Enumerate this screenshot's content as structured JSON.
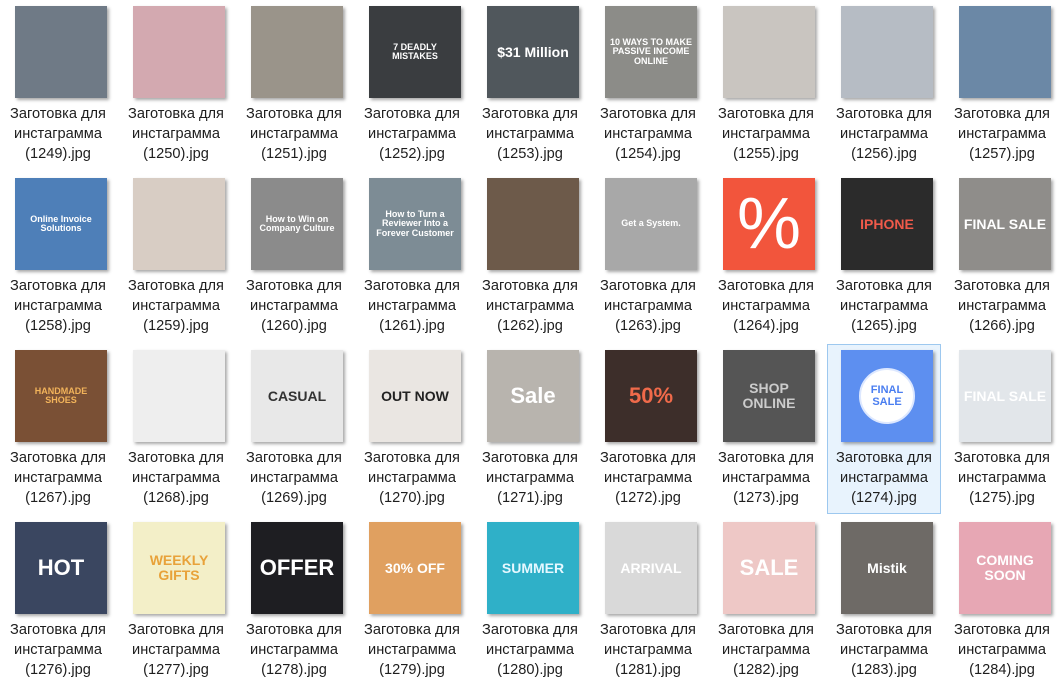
{
  "grid": {
    "columns": 9,
    "selected_index": 25
  },
  "files": [
    {
      "name_line1": "Заготовка для",
      "name_line2": "инстаграмма",
      "name_line3": "(1249).jpg",
      "bg": "#6f7a86",
      "overlay": "",
      "overlay_color": "#ffffff"
    },
    {
      "name_line1": "Заготовка для",
      "name_line2": "инстаграмма",
      "name_line3": "(1250).jpg",
      "bg": "#d3a9b0",
      "overlay": "",
      "overlay_color": "#ffffff"
    },
    {
      "name_line1": "Заготовка для",
      "name_line2": "инстаграмма",
      "name_line3": "(1251).jpg",
      "bg": "#9a948a",
      "overlay": "",
      "overlay_color": "#ffffff"
    },
    {
      "name_line1": "Заготовка для",
      "name_line2": "инстаграмма",
      "name_line3": "(1252).jpg",
      "bg": "#3a3d40",
      "overlay": "7 DEADLY MISTAKES",
      "overlay_color": "#ffffff"
    },
    {
      "name_line1": "Заготовка для",
      "name_line2": "инстаграмма",
      "name_line3": "(1253).jpg",
      "bg": "#50575c",
      "overlay": "$31 Million",
      "overlay_color": "#ffffff"
    },
    {
      "name_line1": "Заготовка для",
      "name_line2": "инстаграмма",
      "name_line3": "(1254).jpg",
      "bg": "#8c8c88",
      "overlay": "10 WAYS TO MAKE PASSIVE INCOME ONLINE",
      "overlay_color": "#ffffff"
    },
    {
      "name_line1": "Заготовка для",
      "name_line2": "инстаграмма",
      "name_line3": "(1255).jpg",
      "bg": "#c9c5c0",
      "overlay": "",
      "overlay_color": "#ffffff"
    },
    {
      "name_line1": "Заготовка для",
      "name_line2": "инстаграмма",
      "name_line3": "(1256).jpg",
      "bg": "#b6bcc4",
      "overlay": "",
      "overlay_color": "#ffffff"
    },
    {
      "name_line1": "Заготовка для",
      "name_line2": "инстаграмма",
      "name_line3": "(1257).jpg",
      "bg": "#6b88a6",
      "overlay": "",
      "overlay_color": "#ffffff"
    },
    {
      "name_line1": "Заготовка для",
      "name_line2": "инстаграмма",
      "name_line3": "(1258).jpg",
      "bg": "#4e7fb8",
      "overlay": "Online Invoice Solutions",
      "overlay_color": "#ffffff"
    },
    {
      "name_line1": "Заготовка для",
      "name_line2": "инстаграмма",
      "name_line3": "(1259).jpg",
      "bg": "#d8cdc4",
      "overlay": "",
      "overlay_color": "#ffffff"
    },
    {
      "name_line1": "Заготовка для",
      "name_line2": "инстаграмма",
      "name_line3": "(1260).jpg",
      "bg": "#8b8b8b",
      "overlay": "How to Win on Company Culture",
      "overlay_color": "#ffffff"
    },
    {
      "name_line1": "Заготовка для",
      "name_line2": "инстаграмма",
      "name_line3": "(1261).jpg",
      "bg": "#7d8c95",
      "overlay": "How to Turn a Reviewer Into a Forever Customer",
      "overlay_color": "#ffffff"
    },
    {
      "name_line1": "Заготовка для",
      "name_line2": "инстаграмма",
      "name_line3": "(1262).jpg",
      "bg": "#6d5a4a",
      "overlay": "",
      "overlay_color": "#ffffff"
    },
    {
      "name_line1": "Заготовка для",
      "name_line2": "инстаграмма",
      "name_line3": "(1263).jpg",
      "bg": "#a8a8a8",
      "overlay": "Get a System.",
      "overlay_color": "#ffffff"
    },
    {
      "name_line1": "Заготовка для",
      "name_line2": "инстаграмма",
      "name_line3": "(1264).jpg",
      "bg": "#f2553c",
      "overlay": "%",
      "overlay_color": "#ffffff"
    },
    {
      "name_line1": "Заготовка для",
      "name_line2": "инстаграмма",
      "name_line3": "(1265).jpg",
      "bg": "#2b2b2b",
      "overlay": "IPHONE",
      "overlay_color": "#f05a4a"
    },
    {
      "name_line1": "Заготовка для",
      "name_line2": "инстаграмма",
      "name_line3": "(1266).jpg",
      "bg": "#8f8d8a",
      "overlay": "FINAL SALE",
      "overlay_color": "#ffffff"
    },
    {
      "name_line1": "Заготовка для",
      "name_line2": "инстаграмма",
      "name_line3": "(1267).jpg",
      "bg": "#7a5035",
      "overlay": "HANDMADE SHOES",
      "overlay_color": "#f2b35a"
    },
    {
      "name_line1": "Заготовка для",
      "name_line2": "инстаграмма",
      "name_line3": "(1268).jpg",
      "bg": "#eeeeee",
      "overlay": "",
      "overlay_color": "#3a5a8a"
    },
    {
      "name_line1": "Заготовка для",
      "name_line2": "инстаграмма",
      "name_line3": "(1269).jpg",
      "bg": "#e8e8e8",
      "overlay": "CASUAL",
      "overlay_color": "#333333"
    },
    {
      "name_line1": "Заготовка для",
      "name_line2": "инстаграмма",
      "name_line3": "(1270).jpg",
      "bg": "#eae6e2",
      "overlay": "OUT NOW",
      "overlay_color": "#222222"
    },
    {
      "name_line1": "Заготовка для",
      "name_line2": "инстаграмма",
      "name_line3": "(1271).jpg",
      "bg": "#b8b4ae",
      "overlay": "Sale",
      "overlay_color": "#ffffff"
    },
    {
      "name_line1": "Заготовка для",
      "name_line2": "инстаграмма",
      "name_line3": "(1272).jpg",
      "bg": "#3d2e2a",
      "overlay": "50%",
      "overlay_color": "#f06a4a"
    },
    {
      "name_line1": "Заготовка для",
      "name_line2": "инстаграмма",
      "name_line3": "(1273).jpg",
      "bg": "#555555",
      "overlay": "SHOP ONLINE",
      "overlay_color": "#cccccc"
    },
    {
      "name_line1": "Заготовка для",
      "name_line2": "инстаграмма",
      "name_line3": "(1274).jpg",
      "bg": "#5d8ff0",
      "overlay": "FINAL SALE",
      "overlay_color": "#4a7ef0"
    },
    {
      "name_line1": "Заготовка для",
      "name_line2": "инстаграмма",
      "name_line3": "(1275).jpg",
      "bg": "#e2e6ea",
      "overlay": "FINAL SALE",
      "overlay_color": "#ffffff"
    },
    {
      "name_line1": "Заготовка для",
      "name_line2": "инстаграмма",
      "name_line3": "(1276).jpg",
      "bg": "#3a4660",
      "overlay": "HOT",
      "overlay_color": "#ffffff"
    },
    {
      "name_line1": "Заготовка для",
      "name_line2": "инстаграмма",
      "name_line3": "(1277).jpg",
      "bg": "#f3efc8",
      "overlay": "WEEKLY GIFTS",
      "overlay_color": "#e8a23a"
    },
    {
      "name_line1": "Заготовка для",
      "name_line2": "инстаграмма",
      "name_line3": "(1278).jpg",
      "bg": "#1e1e22",
      "overlay": "OFFER",
      "overlay_color": "#ffffff"
    },
    {
      "name_line1": "Заготовка для",
      "name_line2": "инстаграмма",
      "name_line3": "(1279).jpg",
      "bg": "#e0a060",
      "overlay": "30% OFF",
      "overlay_color": "#ffffff"
    },
    {
      "name_line1": "Заготовка для",
      "name_line2": "инстаграмма",
      "name_line3": "(1280).jpg",
      "bg": "#2fb0c8",
      "overlay": "SUMMER",
      "overlay_color": "#e6f8ff"
    },
    {
      "name_line1": "Заготовка для",
      "name_line2": "инстаграмма",
      "name_line3": "(1281).jpg",
      "bg": "#d9d9d9",
      "overlay": "ARRIVAL",
      "overlay_color": "#ffffff"
    },
    {
      "name_line1": "Заготовка для",
      "name_line2": "инстаграмма",
      "name_line3": "(1282).jpg",
      "bg": "#eec8c6",
      "overlay": "SALE",
      "overlay_color": "#ffffff"
    },
    {
      "name_line1": "Заготовка для",
      "name_line2": "инстаграмма",
      "name_line3": "(1283).jpg",
      "bg": "#6e6a66",
      "overlay": "Mistik",
      "overlay_color": "#ffffff"
    },
    {
      "name_line1": "Заготовка для",
      "name_line2": "инстаграмма",
      "name_line3": "(1284).jpg",
      "bg": "#e7a7b4",
      "overlay": "COMING SOON",
      "overlay_color": "#ffffff"
    }
  ]
}
